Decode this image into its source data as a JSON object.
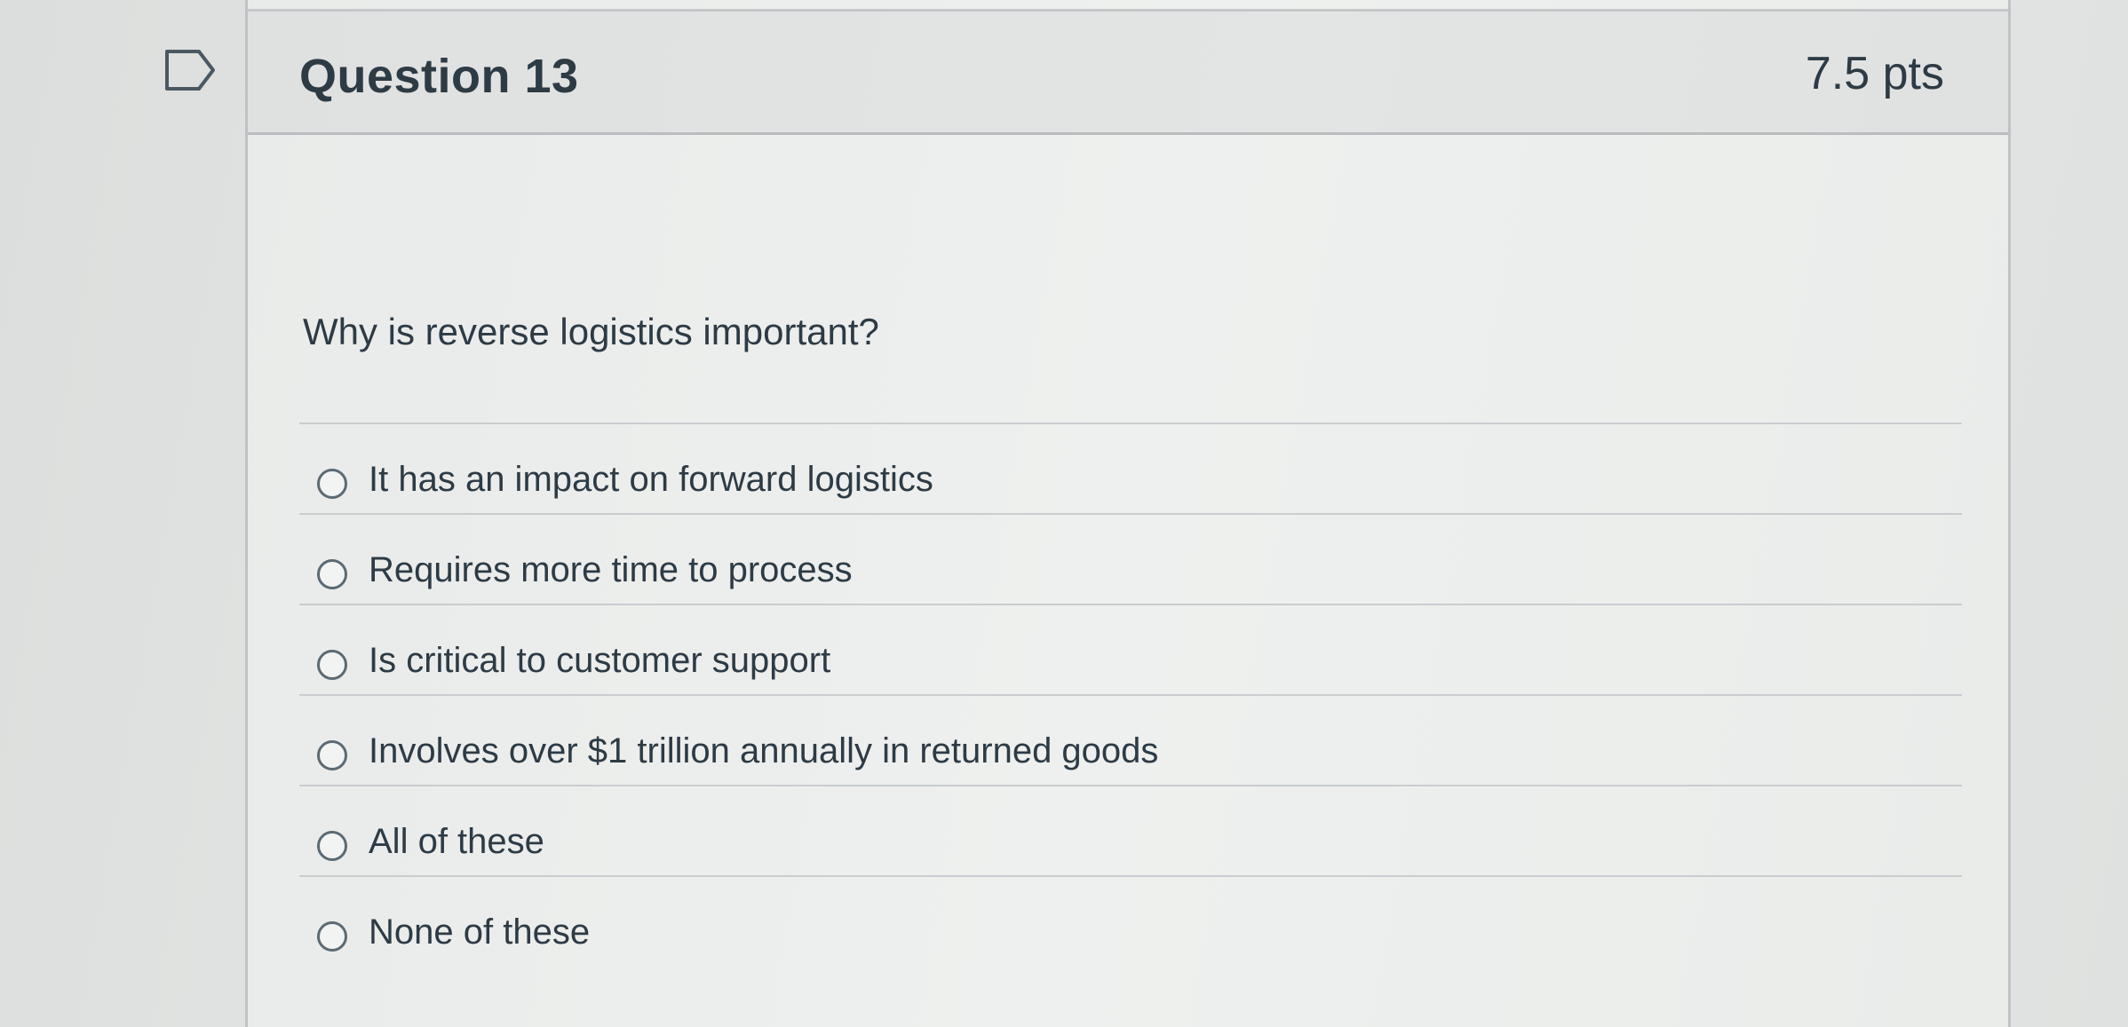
{
  "question": {
    "title": "Question 13",
    "points": "7.5 pts",
    "prompt": "Why is reverse logistics important?",
    "flag_icon": "flag-icon",
    "answers": [
      {
        "label": "It has an impact on forward logistics",
        "selected": false
      },
      {
        "label": "Requires more time to process",
        "selected": false
      },
      {
        "label": "Is critical to customer support",
        "selected": false
      },
      {
        "label": "Involves over $1 trillion annually in returned goods",
        "selected": false
      },
      {
        "label": "All of these",
        "selected": false
      },
      {
        "label": "None of these",
        "selected": false
      }
    ]
  }
}
